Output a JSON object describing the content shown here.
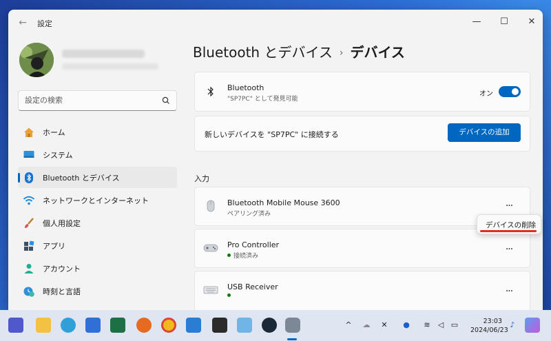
{
  "window": {
    "app_title": "設定",
    "minimize": "—",
    "maximize": "☐",
    "close": "✕"
  },
  "search": {
    "placeholder": "設定の検索"
  },
  "nav": {
    "items": [
      {
        "label": "ホーム",
        "icon": "home-icon"
      },
      {
        "label": "システム",
        "icon": "system-display-icon"
      },
      {
        "label": "Bluetooth とデバイス",
        "icon": "bluetooth-icon",
        "active": true
      },
      {
        "label": "ネットワークとインターネット",
        "icon": "wifi-icon"
      },
      {
        "label": "個人用設定",
        "icon": "brush-icon"
      },
      {
        "label": "アプリ",
        "icon": "apps-icon"
      },
      {
        "label": "アカウント",
        "icon": "account-icon"
      },
      {
        "label": "時刻と言語",
        "icon": "time-language-icon"
      }
    ]
  },
  "breadcrumb": {
    "parent": "Bluetooth とデバイス",
    "separator": "›",
    "current": "デバイス"
  },
  "bluetooth_card": {
    "title": "Bluetooth",
    "subtitle": "\"SP7PC\" として発見可能",
    "toggle_label": "オン",
    "toggle_on": true
  },
  "add_device_card": {
    "text": "新しいデバイスを \"SP7PC\" に接続する",
    "button": "デバイスの追加"
  },
  "section": {
    "label": "入力"
  },
  "devices": [
    {
      "name": "Bluetooth Mobile Mouse 3600",
      "status": "ペアリング済み",
      "icon": "mouse-icon",
      "connected": false
    },
    {
      "name": "Pro Controller",
      "status": "接続済み",
      "icon": "gamepad-icon",
      "connected": true
    },
    {
      "name": "USB Receiver",
      "status": "",
      "icon": "keyboard-icon",
      "connected": true
    }
  ],
  "more_label": "···",
  "context_menu": {
    "item": "デバイスの削除",
    "accent_color": "#e22d1a"
  },
  "taskbar": {
    "apps": [
      "teams-icon",
      "file-explorer-icon",
      "edge-icon",
      "store-icon",
      "excel-icon",
      "firefox-icon",
      "chrome-icon",
      "todo-icon",
      "terminal-icon",
      "notepad-icon",
      "steam-icon",
      "settings-icon"
    ],
    "tray": {
      "chevron": "^",
      "time": "23:03",
      "date": "2024/06/23"
    }
  },
  "colors": {
    "accent": "#0067c0",
    "connected": "#0f7b0f"
  }
}
